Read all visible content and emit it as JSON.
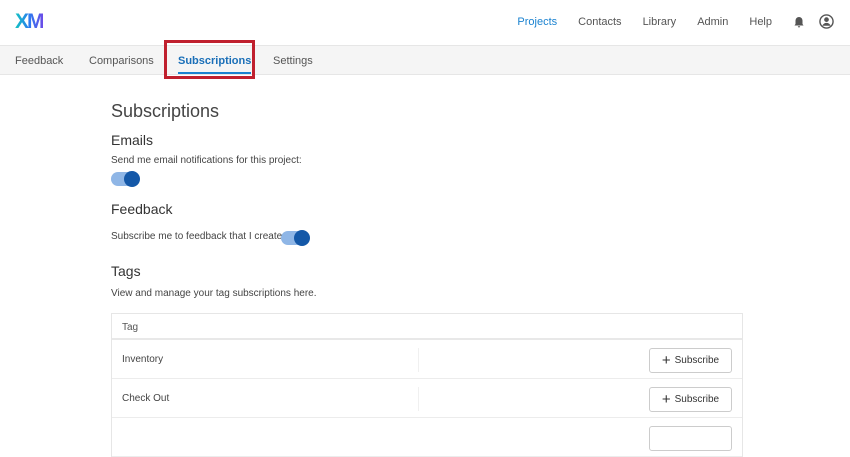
{
  "header": {
    "logo": "XM",
    "nav": [
      "Projects",
      "Contacts",
      "Library",
      "Admin",
      "Help"
    ],
    "active_nav": "Projects"
  },
  "tabs": [
    "Feedback",
    "Comparisons",
    "Subscriptions",
    "Settings"
  ],
  "page": {
    "title": "Subscriptions",
    "emails": {
      "heading": "Emails",
      "label": "Send me email notifications for this project:",
      "enabled": true
    },
    "feedback": {
      "heading": "Feedback",
      "label": "Subscribe me to feedback that I create:",
      "enabled": true
    },
    "tags": {
      "heading": "Tags",
      "description": "View and manage your tag subscriptions here.",
      "column": "Tag",
      "rows": [
        {
          "name": "Inventory",
          "action": "Subscribe"
        },
        {
          "name": "Check Out",
          "action": "Subscribe"
        },
        {
          "name": "",
          "action": ""
        }
      ]
    }
  }
}
